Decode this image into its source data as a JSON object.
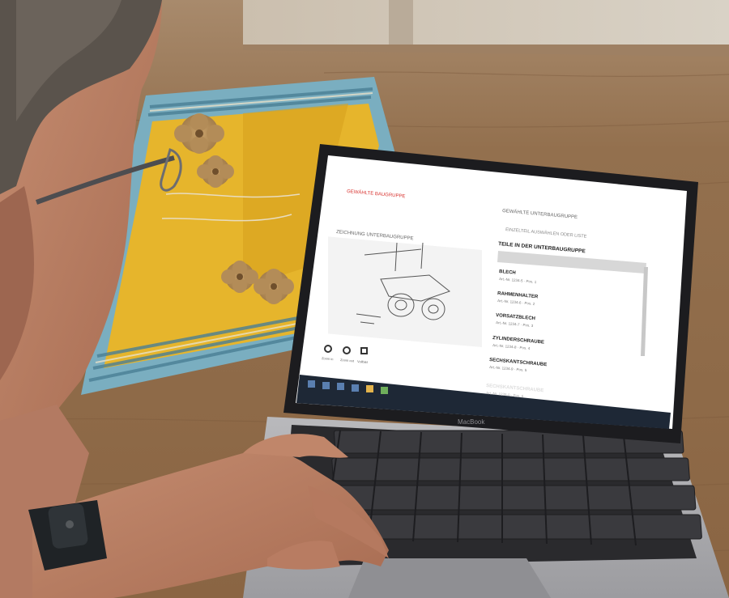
{
  "laptop": {
    "brand": "MacBook",
    "screen": {
      "top_link": "GEWÄHLTE BAUGRUPPE",
      "left_heading": "ZEICHNUNG UNTERBAUGRUPPE",
      "right_title": "GEWÄHLTE UNTERBAUGRUPPE",
      "right_hint": "EINZELTEIL AUSWÄHLEN ODER LISTE",
      "parts_heading": "TEILE IN DER UNTERBAUGRUPPE",
      "parts": [
        {
          "name": "BLECH",
          "detail": "Art.-Nr. 1234-5 · Pos. 1"
        },
        {
          "name": "RAHMENHALTER",
          "detail": "Art.-Nr. 1234-6 · Pos. 2"
        },
        {
          "name": "VORSATZBLECH",
          "detail": "Art.-Nr. 1234-7 · Pos. 3"
        },
        {
          "name": "ZYLINDERSCHRAUBE",
          "detail": "Art.-Nr. 1234-8 · Pos. 4"
        },
        {
          "name": "SECHSKANTSCHRAUBE",
          "detail": "Art.-Nr. 1234-9 · Pos. 5"
        },
        {
          "name": "SECHSKANTSCHRAUBE",
          "detail": "Art.-Nr. 1235-0 · Pos. 6"
        }
      ],
      "zoom_labels": [
        "Zoom in",
        "Zoom out",
        "Vollbild"
      ],
      "accent_color": "#d8322e"
    }
  }
}
